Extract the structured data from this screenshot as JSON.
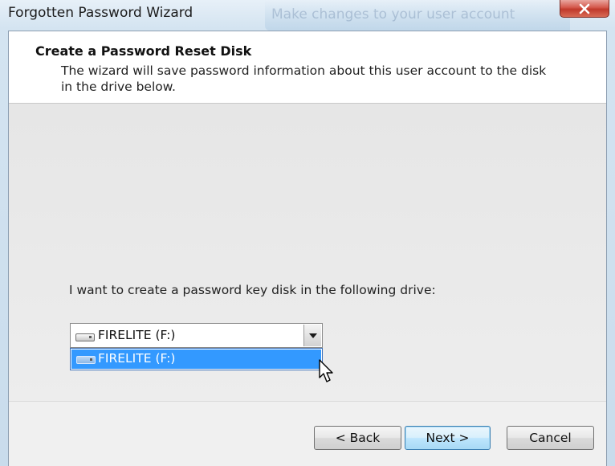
{
  "window": {
    "title": "Forgotten Password Wizard",
    "background_hint": "Make changes to your user account"
  },
  "header": {
    "title": "Create a Password Reset Disk",
    "description": "The wizard will save password information about this user account to the disk in the drive below."
  },
  "body": {
    "prompt": "I want to create a password key disk in the following drive:",
    "drive_select": {
      "selected": "FIRELITE (F:)",
      "options": [
        "FIRELITE (F:)"
      ],
      "icon": "drive-icon"
    }
  },
  "buttons": {
    "back": "< Back",
    "next": "Next >",
    "cancel": "Cancel"
  },
  "colors": {
    "selection": "#3399ff",
    "close_button": "#c0392b"
  }
}
